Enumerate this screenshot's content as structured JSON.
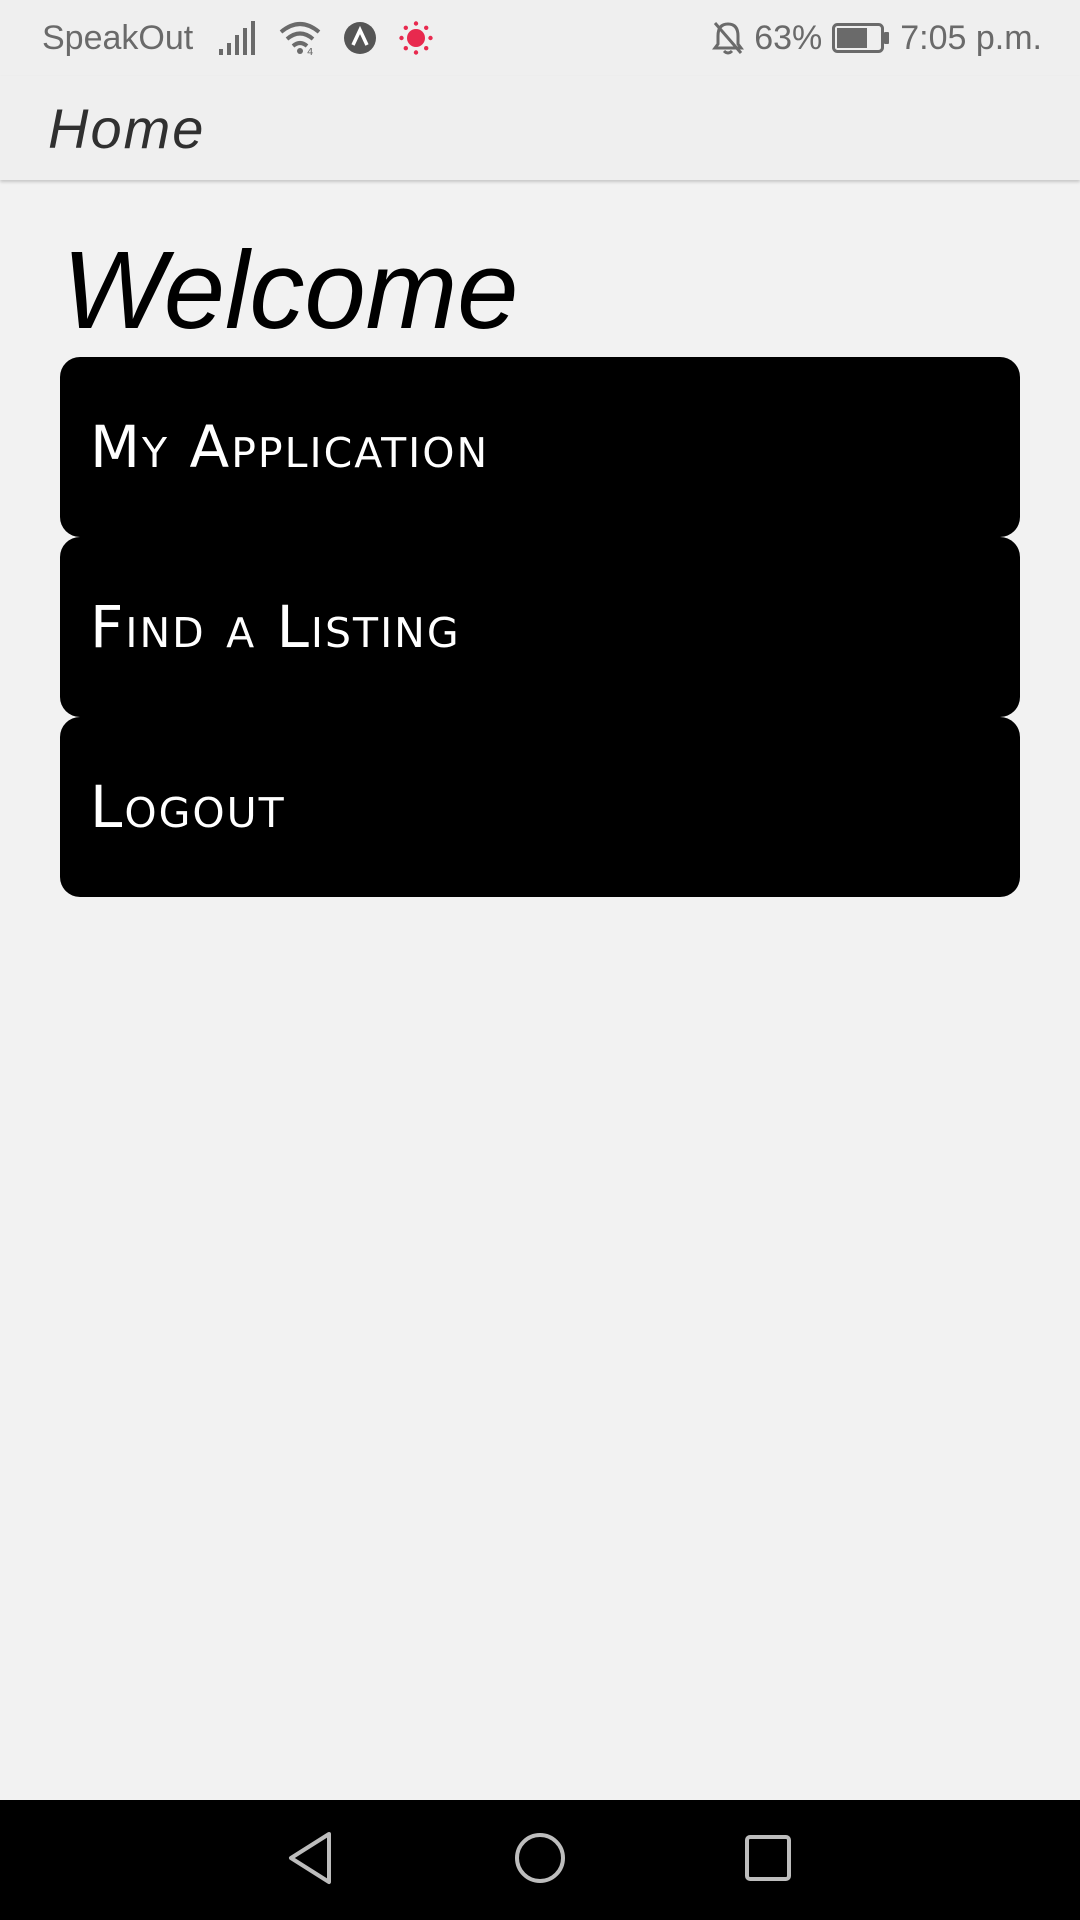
{
  "status_bar": {
    "app_name": "SpeakOut",
    "battery": "63%",
    "time": "7:05 p.m.",
    "icons": [
      "signal-icon",
      "wifi-icon",
      "navigation-icon",
      "recording-icon",
      "bell-off-icon",
      "battery-icon"
    ],
    "colors": {
      "recording": "#e8294e",
      "text": "#6a6a6a"
    }
  },
  "app_bar": {
    "title": "Home"
  },
  "main": {
    "heading": "Welcome",
    "buttons": [
      {
        "label": "My Application"
      },
      {
        "label": "Find a Listing"
      },
      {
        "label": "Logout"
      }
    ]
  },
  "nav_bar": {
    "icons": [
      "back-icon",
      "home-icon",
      "recents-icon"
    ]
  }
}
